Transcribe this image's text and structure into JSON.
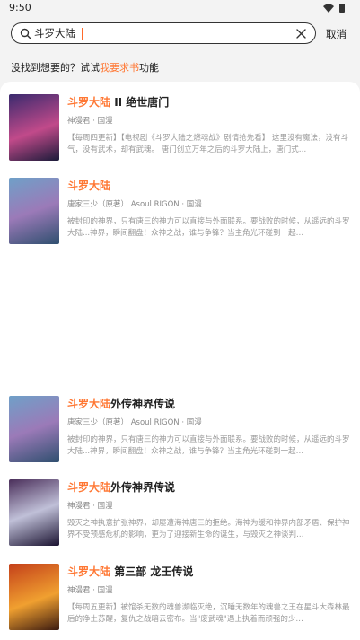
{
  "status": {
    "time": "9:50"
  },
  "search": {
    "query": "斗罗大陆",
    "cancel_label": "取消"
  },
  "request": {
    "prefix": "没找到想要的？试试",
    "link": "我要求书",
    "suffix": "功能"
  },
  "books": [
    {
      "title_highlight": "斗罗大陆",
      "title_rest": " II 绝世唐门",
      "meta": "神漫君 · 国漫",
      "desc": "【每周四更新】【电视剧《斗罗大陆之燃魂战》剧情抢先看】 这里没有魔法，没有斗气，没有武术，却有武魂。 唐门创立万年之后的斗罗大陆上，唐门式…",
      "cover_colors": [
        "#3a2a6e",
        "#c14a8a",
        "#1b1b3a"
      ]
    },
    {
      "title_highlight": "斗罗大陆",
      "title_rest": "",
      "meta": "唐家三少（原著） Asoul RIGON · 国漫",
      "desc": "被封印的神界，只有唐三的神力可以直接与外面联系。要战败的时候，从遥远的斗罗大陆...神界，瞬间翻盘！众神之战，谁与争锋？当主角光环碰到一起…",
      "cover_colors": [
        "#6fa0c8",
        "#9b7ab8",
        "#2f4f6f"
      ]
    },
    {
      "title_highlight": "斗罗大陆",
      "title_rest": "外传神界传说",
      "meta": "唐家三少（原著） Asoul RIGON · 国漫",
      "desc": "被封印的神界，只有唐三的神力可以直接与外面联系。要战败的时候，从遥远的斗罗大陆...神界，瞬间翻盘！众神之战，谁与争锋？当主角光环碰到一起…",
      "cover_colors": [
        "#6fa0c8",
        "#9b7ab8",
        "#2f4f6f"
      ]
    },
    {
      "title_highlight": "斗罗大陆",
      "title_rest": "外传神界传说",
      "meta": "神漫君 · 国漫",
      "desc": "毁灭之神执意扩张神界，却屡遭海神唐三的拒绝。海神为缓和神界内部矛盾、保护神界不受预感危机的影响，更为了迎接新生命的诞生，与毁灭之神谈判…",
      "cover_colors": [
        "#4a2e5a",
        "#c0c0d8",
        "#1a1230"
      ]
    },
    {
      "title_highlight": "斗罗大陆",
      "title_rest": " 第三部 龙王传说",
      "meta": "神漫君 · 国漫",
      "desc": "【每周五更新】被馆杀无数的魂兽濒临灭绝，沉睡无数年的魂兽之王在星斗大森林最后的净土苏醒，复仇之战暗云密布。当\"废武魂\"遇上执着而顽强的少…",
      "cover_colors": [
        "#c4401a",
        "#f0a030",
        "#3a1a10"
      ]
    }
  ]
}
